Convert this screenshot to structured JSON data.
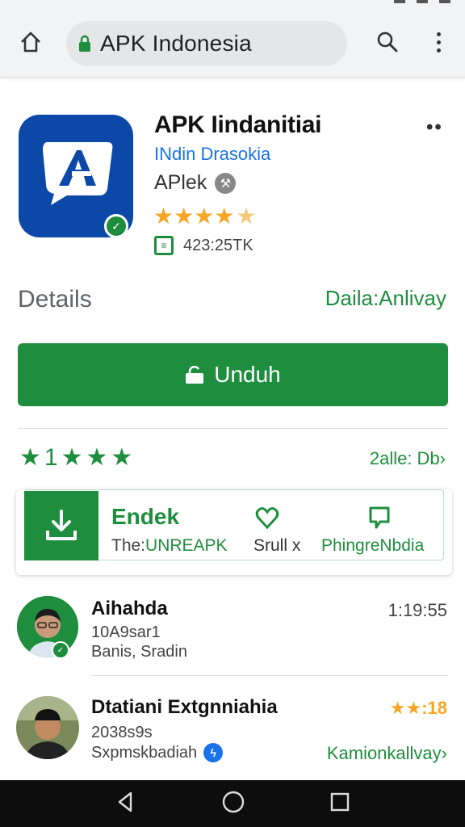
{
  "browser": {
    "url_text": "APK Indonesia"
  },
  "app": {
    "title": "APK Iindanitiai",
    "developer": "INdin Drasokia",
    "category": "APlek",
    "rating_stars": "★★★★",
    "half_star": "★",
    "downloads": "423:25TK",
    "verified_glyph": "✓",
    "more_dots": "••"
  },
  "details": {
    "label": "Details",
    "link": "Daila:Anlivay"
  },
  "install": {
    "label": "Unduh"
  },
  "rating_row": {
    "stars": "★1★★★",
    "link": "2alle: Db›"
  },
  "feature": {
    "title": "Endek",
    "sub_prefix": "The:",
    "sub_highlight": "UNREAPK",
    "heart_label": "Srull x",
    "chat_label": "PhingreNbdia"
  },
  "reviews": [
    {
      "name": "Aihahda",
      "line1": "10A9sar1",
      "line2": "Banis, Sradin",
      "time": "1:19:55"
    },
    {
      "name": "Dtatiani Extgnniahia",
      "line1": "2038s9s",
      "line2": "Sxpmskbadiah",
      "stars": "★★:18",
      "link": "Kamionkallvay›"
    }
  ],
  "colors": {
    "accent_green": "#1e8e3e",
    "brand_blue": "#0b48a8",
    "star_orange": "#f5a623",
    "link_blue": "#1a73e8"
  }
}
